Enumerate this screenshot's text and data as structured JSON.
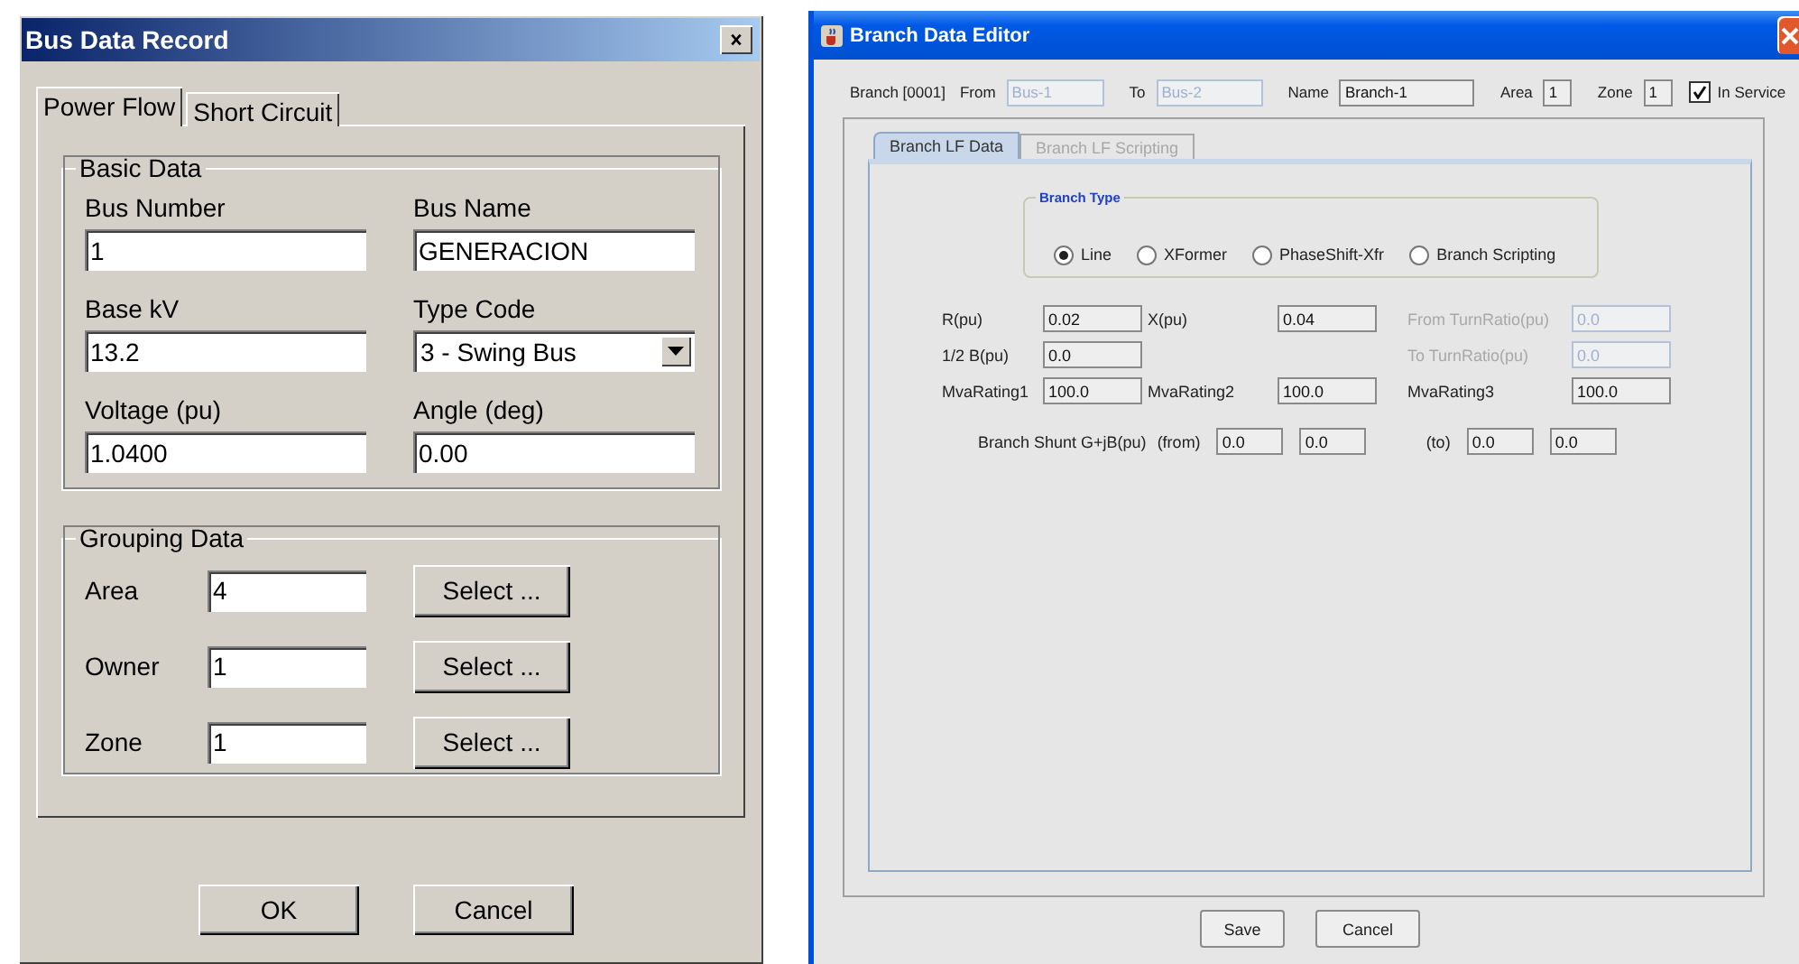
{
  "bus_dialog": {
    "title": "Bus Data Record",
    "tabs": [
      {
        "label": "Power Flow",
        "selected": true
      },
      {
        "label": "Short Circuit",
        "selected": false
      }
    ],
    "basic_data": {
      "legend": "Basic Data",
      "fields": [
        {
          "label": "Bus Number",
          "value": "1",
          "kind": "text"
        },
        {
          "label": "Bus Name",
          "value": "GENERACION",
          "kind": "text"
        },
        {
          "label": "Base kV",
          "value": "13.2",
          "kind": "text"
        },
        {
          "label": "Type Code",
          "value": "3 - Swing Bus",
          "kind": "select"
        },
        {
          "label": "Voltage (pu)",
          "value": "1.0400",
          "kind": "text"
        },
        {
          "label": "Angle (deg)",
          "value": "0.00",
          "kind": "text"
        }
      ]
    },
    "grouping_data": {
      "legend": "Grouping Data",
      "rows": [
        {
          "label": "Area",
          "value": "4",
          "button": "Select ..."
        },
        {
          "label": "Owner",
          "value": "1",
          "button": "Select ..."
        },
        {
          "label": "Zone",
          "value": "1",
          "button": "Select ..."
        }
      ]
    },
    "buttons": [
      "OK",
      "Cancel"
    ]
  },
  "branch_dialog": {
    "title": "Branch Data Editor",
    "branch_id": "Branch [0001]",
    "header_fields": [
      {
        "label": "From",
        "value": "Bus-1",
        "disabled": true
      },
      {
        "label": "To",
        "value": "Bus-2",
        "disabled": true
      },
      {
        "label": "Name",
        "value": "Branch-1",
        "disabled": false
      },
      {
        "label": "Area",
        "value": "1",
        "disabled": false
      },
      {
        "label": "Zone",
        "value": "1",
        "disabled": false
      }
    ],
    "in_service": {
      "label": "In Service",
      "checked": true
    },
    "tabs": [
      {
        "label": "Branch LF Data",
        "selected": true,
        "disabled": false
      },
      {
        "label": "Branch LF Scripting",
        "selected": false,
        "disabled": true
      }
    ],
    "branch_type": {
      "legend": "Branch Type",
      "options": [
        {
          "label": "Line",
          "selected": true
        },
        {
          "label": "XFormer",
          "selected": false
        },
        {
          "label": "PhaseShift-Xfr",
          "selected": false
        },
        {
          "label": "Branch Scripting",
          "selected": false
        }
      ]
    },
    "rows": [
      {
        "cells": [
          {
            "label": "R(pu)",
            "value": "0.02",
            "disabled": false
          },
          {
            "label": "X(pu)",
            "value": "0.04",
            "disabled": false
          },
          {
            "label": "From TurnRatio(pu)",
            "value": "0.0",
            "disabled": true
          }
        ]
      },
      {
        "cells": [
          {
            "label": "1/2 B(pu)",
            "value": "0.0",
            "disabled": false
          },
          null,
          {
            "label": "To TurnRatio(pu)",
            "value": "0.0",
            "disabled": true
          }
        ]
      },
      {
        "cells": [
          {
            "label": "MvaRating1",
            "value": "100.0",
            "disabled": false
          },
          {
            "label": "MvaRating2",
            "value": "100.0",
            "disabled": false
          },
          {
            "label": "MvaRating3",
            "value": "100.0",
            "disabled": false
          }
        ]
      }
    ],
    "shunt": {
      "label": "Branch Shunt G+jB(pu)",
      "groups": [
        {
          "label": "(from)",
          "values": [
            "0.0",
            "0.0"
          ]
        },
        {
          "label": "(to)",
          "values": [
            "0.0",
            "0.0"
          ]
        }
      ]
    },
    "buttons": [
      "Save",
      "Cancel"
    ]
  }
}
